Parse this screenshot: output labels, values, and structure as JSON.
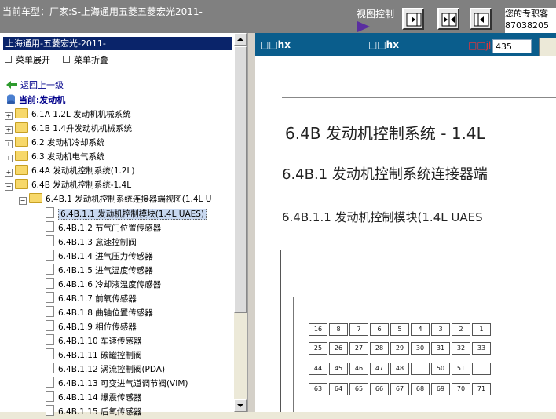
{
  "header": {
    "title": "当前车型：厂家:S-上海通用五菱五菱宏光2011-",
    "view_control_label": "视图控制",
    "service_text_line1": "您的专职客",
    "service_text_line2": "87038205"
  },
  "left": {
    "model_label": "上海通用-五菱宏光-2011-",
    "expand_label": "菜单展开",
    "collapse_label": "菜单折叠",
    "back_label": "返回上一级",
    "current_label": "当前:发动机",
    "tree": [
      {
        "label": "6.1A 1.2L 发动机机械系统"
      },
      {
        "label": "6.1B 1.4升发动机机械系统"
      },
      {
        "label": "6.2 发动机冷却系统"
      },
      {
        "label": "6.3 发动机电气系统"
      },
      {
        "label": "6.4A 发动机控制系统(1.2L)"
      },
      {
        "label": "6.4B 发动机控制系统-1.4L"
      },
      {
        "label": "6.4B.1 发动机控制系统连接器端视图(1.4L U"
      },
      {
        "label": "6.4B.1.1 发动机控制模块(1.4L UAES)"
      },
      {
        "label": "6.4B.1.2 节气门位置传感器"
      },
      {
        "label": "6.4B.1.3 怠速控制阀"
      },
      {
        "label": "6.4B.1.4 进气压力传感器"
      },
      {
        "label": "6.4B.1.5 进气温度传感器"
      },
      {
        "label": "6.4B.1.6 冷却液温度传感器"
      },
      {
        "label": "6.4B.1.7 前氧传感器"
      },
      {
        "label": "6.4B.1.8 曲轴位置传感器"
      },
      {
        "label": "6.4B.1.9 相位传感器"
      },
      {
        "label": "6.4B.1.10 车速传感器"
      },
      {
        "label": "6.4B.1.11 碳罐控制阀"
      },
      {
        "label": "6.4B.1.12 涡流控制阀(PDA)"
      },
      {
        "label": "6.4B.1.13 可变进气道调节阀(VIM)"
      },
      {
        "label": "6.4B.1.14 爆震传感器"
      },
      {
        "label": "6.4B.1.15 后氧传感器"
      }
    ]
  },
  "right": {
    "tab1": "□□hx",
    "tab2": "□□hx",
    "page_label": "□□jl",
    "page_value": "435",
    "doc": {
      "heading1": "6.4B   发动机控制系统 - 1.4L",
      "heading2": "6.4B.1 发动机控制系统连接器端",
      "heading3": "6.4B.1.1 发动机控制模块(1.4L UAES",
      "row1": [
        "16",
        "8",
        "7",
        "6",
        "5",
        "4",
        "3",
        "2",
        "1"
      ],
      "row2": [
        "25",
        "26",
        "27",
        "28",
        "29",
        "30",
        "31",
        "32",
        "33"
      ],
      "row3": [
        "44",
        "45",
        "46",
        "47",
        "48",
        "",
        "50",
        "51",
        ""
      ],
      "row4": [
        "63",
        "64",
        "65",
        "66",
        "67",
        "68",
        "69",
        "70",
        "71"
      ]
    }
  }
}
